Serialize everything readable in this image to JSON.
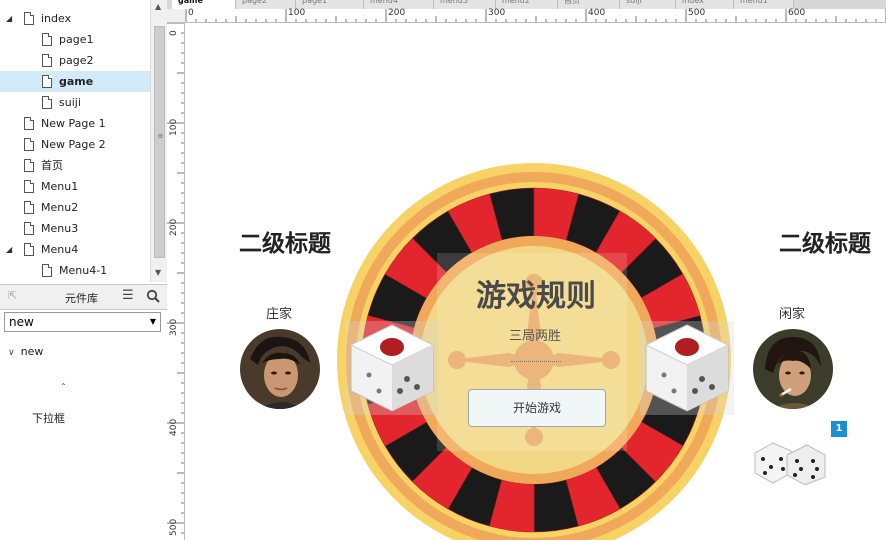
{
  "pages": {
    "items": [
      {
        "label": "index",
        "level": 0,
        "expanded": true,
        "selected": false
      },
      {
        "label": "page1",
        "level": 1,
        "selected": false
      },
      {
        "label": "page2",
        "level": 1,
        "selected": false
      },
      {
        "label": "game",
        "level": 1,
        "selected": true
      },
      {
        "label": "suiji",
        "level": 1,
        "selected": false
      },
      {
        "label": "New Page 1",
        "level": 0,
        "selected": false
      },
      {
        "label": "New Page 2",
        "level": 0,
        "selected": false
      },
      {
        "label": "首页",
        "level": 0,
        "selected": false
      },
      {
        "label": "Menu1",
        "level": 0,
        "selected": false
      },
      {
        "label": "Menu2",
        "level": 0,
        "selected": false
      },
      {
        "label": "Menu3",
        "level": 0,
        "selected": false
      },
      {
        "label": "Menu4",
        "level": 0,
        "expanded": true,
        "selected": false
      },
      {
        "label": "Menu4-1",
        "level": 1,
        "selected": false
      }
    ]
  },
  "library": {
    "title": "元件库",
    "selected": "new",
    "group": "new",
    "item_label": "下拉框"
  },
  "tabs": [
    {
      "label": "game",
      "active": true
    },
    {
      "label": "page2",
      "active": false
    },
    {
      "label": "page1",
      "active": false
    },
    {
      "label": "menu4",
      "active": false
    },
    {
      "label": "menu3",
      "active": false
    },
    {
      "label": "menu2",
      "active": false
    },
    {
      "label": "首页",
      "active": false
    },
    {
      "label": "suiji",
      "active": false
    },
    {
      "label": "index",
      "active": false
    },
    {
      "label": "menu1",
      "active": false
    }
  ],
  "ruler": {
    "h_labels": [
      "0",
      "100",
      "200",
      "300",
      "400",
      "500",
      "600"
    ],
    "v_labels": [
      "0",
      "100",
      "200",
      "300",
      "400",
      "500"
    ]
  },
  "game": {
    "left_title": "二级标题",
    "right_title": "二级标题",
    "left_role": "庄家",
    "right_role": "闲家",
    "rules_title": "游戏规则",
    "rules_subtitle": "三局两胜",
    "start_button": "开始游戏",
    "badge": "1"
  },
  "colors": {
    "wheel_outer": "#f6d364",
    "wheel_ring": "#f0a85a",
    "wheel_red": "#e3262d",
    "wheel_black": "#1a1a1a",
    "center": "#f2d784",
    "selection": "#d3ebf8",
    "badge": "#1a8fd6"
  }
}
